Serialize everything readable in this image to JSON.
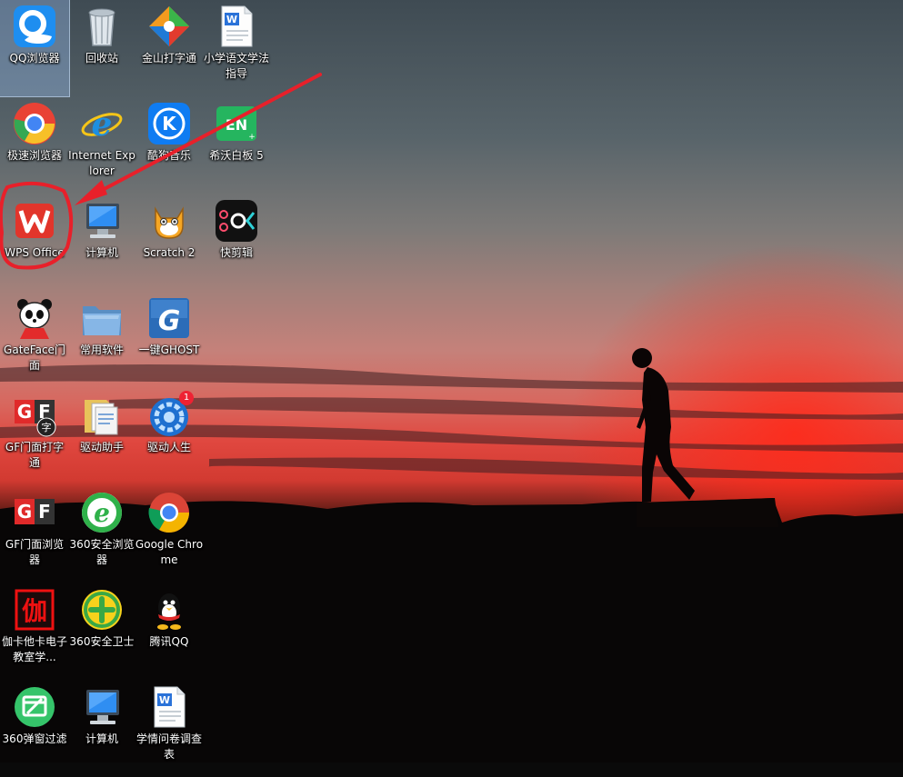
{
  "desktop": {
    "icons": [
      {
        "name": "qq-browser",
        "label": "QQ浏览器",
        "icon": "qq-browser-icon",
        "selected": true
      },
      {
        "name": "recycle-bin",
        "label": "回收站",
        "icon": "recycle-bin-icon"
      },
      {
        "name": "jinshan-typing",
        "label": "金山打字通",
        "icon": "jinshan-typing-icon"
      },
      {
        "name": "word-doc-grammar",
        "label": "小学语文学法指导",
        "icon": "word-document-icon"
      },
      {
        "name": "speed-browser",
        "label": "极速浏览器",
        "icon": "speed-browser-icon"
      },
      {
        "name": "internet-explorer",
        "label": "Internet Explorer",
        "icon": "ie-icon"
      },
      {
        "name": "kugou-music",
        "label": "酷狗音乐",
        "icon": "kugou-icon"
      },
      {
        "name": "seewo-whiteboard",
        "label": "希沃白板 5",
        "icon": "seewo-icon"
      },
      {
        "name": "wps-office",
        "label": "WPS Office",
        "icon": "wps-icon"
      },
      {
        "name": "computer",
        "label": "计算机",
        "icon": "computer-icon"
      },
      {
        "name": "scratch",
        "label": "Scratch 2",
        "icon": "scratch-cat-icon"
      },
      {
        "name": "kuaijianji",
        "label": "快剪辑",
        "icon": "kuaijianji-icon"
      },
      {
        "name": "gateface",
        "label": "GateFace门面",
        "icon": "panda-icon"
      },
      {
        "name": "common-software",
        "label": "常用软件",
        "icon": "folder-icon"
      },
      {
        "name": "ghost",
        "label": "一键GHOST",
        "icon": "ghost-icon"
      },
      {
        "name": "gf-typing",
        "label": "GF门面打字通",
        "icon": "gf-typing-icon"
      },
      {
        "name": "driver-helper",
        "label": "驱动助手",
        "icon": "folder-docs-icon"
      },
      {
        "name": "driver-life",
        "label": "驱动人生",
        "icon": "gear-badge-icon",
        "badge": "1"
      },
      {
        "name": "gf-browser",
        "label": "GF门面浏览器",
        "icon": "gf-icon"
      },
      {
        "name": "browser-360",
        "label": "360安全浏览器",
        "icon": "browser-360-icon"
      },
      {
        "name": "google-chrome",
        "label": "Google Chrome",
        "icon": "chrome-icon"
      },
      {
        "name": "jiakatake",
        "label": "伽卡他卡电子教室学...",
        "icon": "jiakatake-icon"
      },
      {
        "name": "guard-360",
        "label": "360安全卫士",
        "icon": "guard-360-icon"
      },
      {
        "name": "tencent-qq",
        "label": "腾讯QQ",
        "icon": "qq-penguin-icon"
      },
      {
        "name": "popup-filter-360",
        "label": "360弹窗过滤",
        "icon": "popup-filter-icon"
      },
      {
        "name": "computer-2",
        "label": "计算机",
        "icon": "computer-icon"
      },
      {
        "name": "word-doc-survey",
        "label": "学情问卷调查表",
        "icon": "word-document-icon"
      }
    ]
  },
  "annotation": {
    "color": "#e8202a",
    "target": "WPS Office"
  }
}
